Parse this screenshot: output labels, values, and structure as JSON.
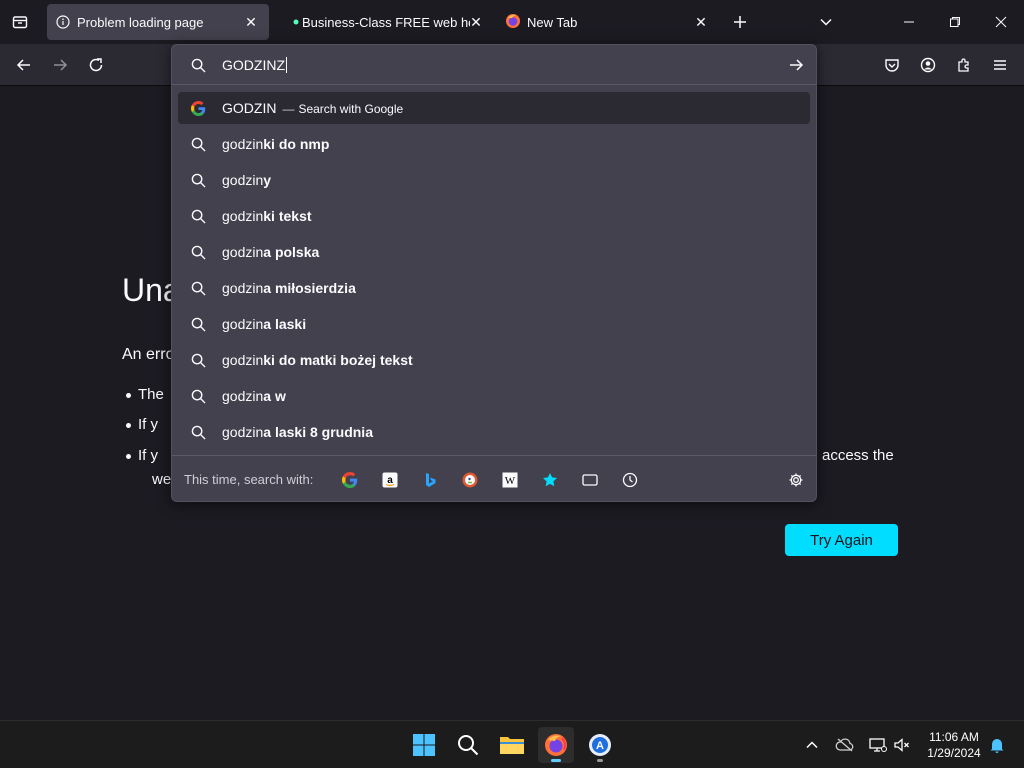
{
  "tabs": [
    {
      "label": "Problem loading page",
      "active": true,
      "icon": "info-icon"
    },
    {
      "label": "Business-Class FREE web hosting",
      "active": false,
      "icon": "dot-icon"
    },
    {
      "label": "New Tab",
      "active": false,
      "icon": "firefox-icon"
    }
  ],
  "urlbar": {
    "typed_value": "GODZINZ",
    "results": [
      {
        "prefix": "GODZIN",
        "suffix": "",
        "separator": "—",
        "action": "Search with Google",
        "icon": "google-icon",
        "selected": true
      },
      {
        "prefix": "godzin",
        "suffix": "ki do nmp",
        "icon": "search-icon"
      },
      {
        "prefix": "godzin",
        "suffix": "y",
        "icon": "search-icon"
      },
      {
        "prefix": "godzin",
        "suffix": "ki tekst",
        "icon": "search-icon"
      },
      {
        "prefix": "godzin",
        "suffix": "a polska",
        "icon": "search-icon"
      },
      {
        "prefix": "godzin",
        "suffix": "a miłosierdzia",
        "icon": "search-icon"
      },
      {
        "prefix": "godzin",
        "suffix": "a laski",
        "icon": "search-icon"
      },
      {
        "prefix": "godzin",
        "suffix": "ki do matki bożej tekst",
        "icon": "search-icon"
      },
      {
        "prefix": "godzin",
        "suffix": "a w",
        "icon": "search-icon"
      },
      {
        "prefix": "godzin",
        "suffix": "a laski 8 grudnia",
        "icon": "search-icon"
      }
    ],
    "oneoff_label": "This time, search with:",
    "oneoff_engines": [
      "google-icon",
      "amazon-icon",
      "bing-icon",
      "duckduckgo-icon",
      "wikipedia-icon",
      "bookmarks-icon",
      "tabs-icon",
      "history-icon"
    ]
  },
  "page": {
    "title_visible": "Una",
    "intro_visible": "An erro",
    "bullets_visible": [
      "The",
      "If y",
      "If y"
    ],
    "right_text_1": "access the",
    "right_text_2": "we",
    "try_again_label": "Try Again"
  },
  "taskbar": {
    "time": "11:06 AM",
    "date": "1/29/2024"
  },
  "colors": {
    "accent": "#00ddff",
    "popup_bg": "#42414d",
    "page_bg": "#1c1b22",
    "taskbar_indicator": "#60cdff"
  }
}
